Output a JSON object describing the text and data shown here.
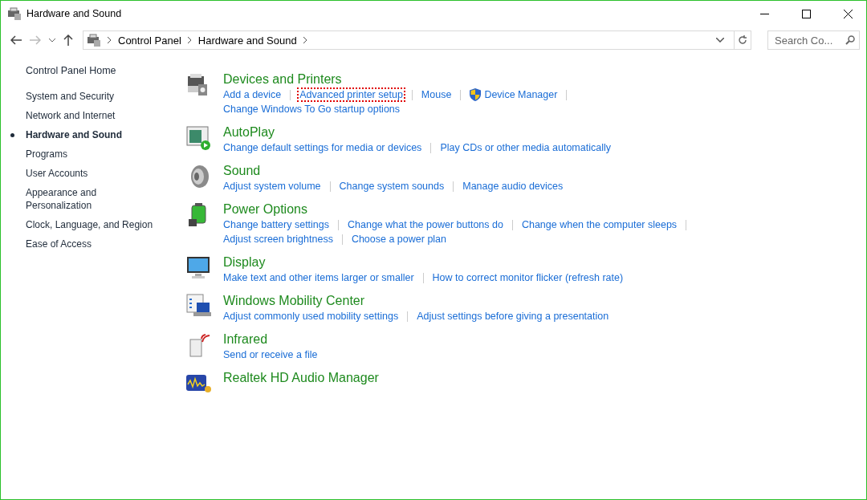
{
  "window": {
    "title": "Hardware and Sound"
  },
  "address_bar": {
    "crumbs": [
      "Control Panel",
      "Hardware and Sound"
    ]
  },
  "search": {
    "placeholder": "Search Co..."
  },
  "sidebar": {
    "home": "Control Panel Home",
    "items": [
      {
        "label": "System and Security",
        "selected": false
      },
      {
        "label": "Network and Internet",
        "selected": false
      },
      {
        "label": "Hardware and Sound",
        "selected": true
      },
      {
        "label": "Programs",
        "selected": false
      },
      {
        "label": "User Accounts",
        "selected": false
      },
      {
        "label": "Appearance and Personalization",
        "selected": false
      },
      {
        "label": "Clock, Language, and Region",
        "selected": false
      },
      {
        "label": "Ease of Access",
        "selected": false
      }
    ]
  },
  "categories": [
    {
      "title": "Devices and Printers",
      "lines": [
        [
          {
            "label": "Add a device",
            "kind": "link",
            "highlighted": false
          },
          {
            "label": "Advanced printer setup",
            "kind": "link",
            "highlighted": true
          },
          {
            "label": "Mouse",
            "kind": "link",
            "highlighted": false
          },
          {
            "label": "Device Manager",
            "kind": "shield",
            "highlighted": false
          }
        ],
        [
          {
            "label": "Change Windows To Go startup options",
            "kind": "link",
            "highlighted": false
          }
        ]
      ]
    },
    {
      "title": "AutoPlay",
      "lines": [
        [
          {
            "label": "Change default settings for media or devices",
            "kind": "link",
            "highlighted": false
          },
          {
            "label": "Play CDs or other media automatically",
            "kind": "link",
            "highlighted": false
          }
        ]
      ]
    },
    {
      "title": "Sound",
      "lines": [
        [
          {
            "label": "Adjust system volume",
            "kind": "link",
            "highlighted": false
          },
          {
            "label": "Change system sounds",
            "kind": "link",
            "highlighted": false
          },
          {
            "label": "Manage audio devices",
            "kind": "link",
            "highlighted": false
          }
        ]
      ]
    },
    {
      "title": "Power Options",
      "lines": [
        [
          {
            "label": "Change battery settings",
            "kind": "link",
            "highlighted": false
          },
          {
            "label": "Change what the power buttons do",
            "kind": "link",
            "highlighted": false
          },
          {
            "label": "Change when the computer sleeps",
            "kind": "link",
            "highlighted": false
          }
        ],
        [
          {
            "label": "Adjust screen brightness",
            "kind": "link",
            "highlighted": false
          },
          {
            "label": "Choose a power plan",
            "kind": "link",
            "highlighted": false
          }
        ]
      ]
    },
    {
      "title": "Display",
      "lines": [
        [
          {
            "label": "Make text and other items larger or smaller",
            "kind": "link",
            "highlighted": false
          },
          {
            "label": "How to correct monitor flicker (refresh rate)",
            "kind": "link",
            "highlighted": false
          }
        ]
      ]
    },
    {
      "title": "Windows Mobility Center",
      "lines": [
        [
          {
            "label": "Adjust commonly used mobility settings",
            "kind": "link",
            "highlighted": false
          },
          {
            "label": "Adjust settings before giving a presentation",
            "kind": "link",
            "highlighted": false
          }
        ]
      ]
    },
    {
      "title": "Infrared",
      "lines": [
        [
          {
            "label": "Send or receive a file",
            "kind": "link",
            "highlighted": false
          }
        ]
      ]
    },
    {
      "title": "Realtek HD Audio Manager"
    }
  ]
}
